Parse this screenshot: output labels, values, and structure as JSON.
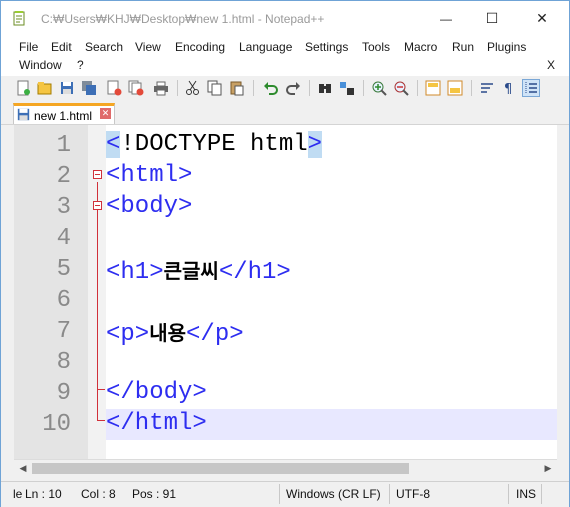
{
  "window": {
    "title": "C:₩Users₩KHJ₩Desktop₩new 1.html - Notepad++",
    "minimize_label": "—",
    "maximize_label": "☐",
    "close_label": "✕"
  },
  "menu": {
    "items": [
      "File",
      "Edit",
      "Search",
      "View",
      "Encoding",
      "Language",
      "Settings",
      "Tools",
      "Macro",
      "Run",
      "Plugins",
      "Window",
      "?"
    ],
    "close_doc_label": "X"
  },
  "toolbar": {
    "icons": [
      "new-file-icon",
      "open-file-icon",
      "save-icon",
      "save-all-icon",
      "close-icon",
      "close-all-icon",
      "print-icon",
      "cut-icon",
      "copy-icon",
      "paste-icon",
      "undo-icon",
      "redo-icon",
      "find-icon",
      "replace-icon",
      "zoom-in-icon",
      "zoom-out-icon",
      "sync-vertical-icon",
      "sync-horizontal-icon",
      "word-wrap-icon",
      "show-all-chars-icon",
      "indent-guide-icon"
    ]
  },
  "tabs": [
    {
      "label": "new 1.html",
      "close": "✕"
    }
  ],
  "editor": {
    "lines": [
      {
        "num": "1",
        "parts": [
          {
            "t": "<",
            "c": "hl"
          },
          {
            "t": "!DOCTYPE html",
            "c": "txt"
          },
          {
            "t": ">",
            "c": "hl"
          }
        ]
      },
      {
        "num": "2",
        "parts": [
          {
            "t": "<html>",
            "c": "tag"
          }
        ]
      },
      {
        "num": "3",
        "parts": [
          {
            "t": "<body>",
            "c": "tag"
          }
        ]
      },
      {
        "num": "4",
        "parts": []
      },
      {
        "num": "5",
        "parts": [
          {
            "t": "<h1>",
            "c": "tag"
          },
          {
            "t": "큰글씨",
            "c": "kr"
          },
          {
            "t": "</h1>",
            "c": "tag"
          }
        ]
      },
      {
        "num": "6",
        "parts": []
      },
      {
        "num": "7",
        "parts": [
          {
            "t": "<p>",
            "c": "tag"
          },
          {
            "t": "내용",
            "c": "kr"
          },
          {
            "t": "</p>",
            "c": "tag"
          }
        ]
      },
      {
        "num": "8",
        "parts": []
      },
      {
        "num": "9",
        "parts": [
          {
            "t": "</body>",
            "c": "tag"
          }
        ]
      },
      {
        "num": "10",
        "parts": [
          {
            "t": "</html>",
            "c": "tag"
          }
        ]
      }
    ]
  },
  "scrollbar": {
    "left": "◀",
    "right": "▶"
  },
  "status": {
    "length": "le",
    "ln": "Ln : 10",
    "col": "Col : 8",
    "pos": "Pos : 91",
    "eol": "Windows (CR LF)",
    "encoding": "UTF-8",
    "mode": "INS"
  },
  "colors": {
    "tag": "#2d2df0",
    "fold_marker": "#d1313a",
    "tab_accent": "#f5a623",
    "brace_highlight": "#c0dcf3",
    "current_line": "#e8e8ff"
  }
}
